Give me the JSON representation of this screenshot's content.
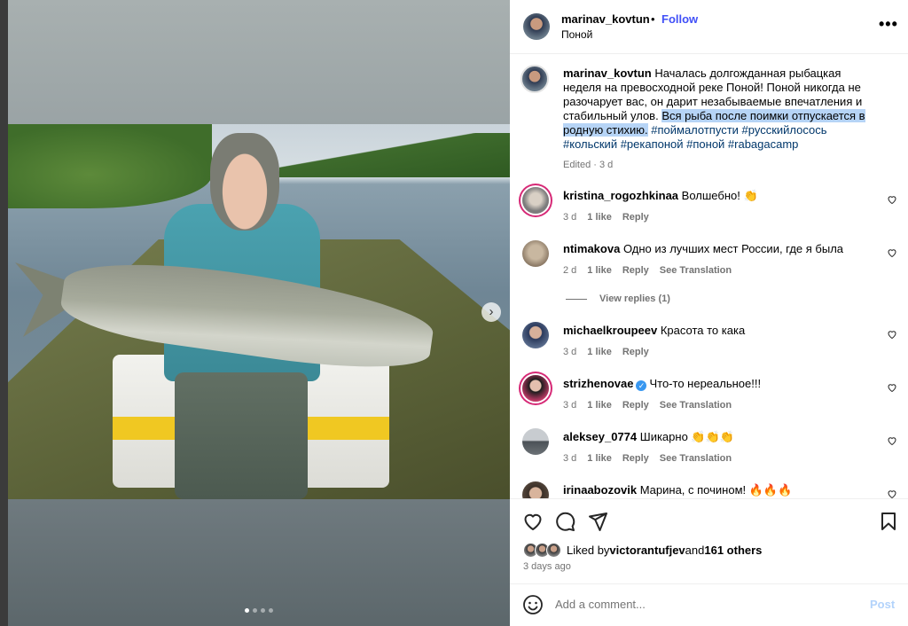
{
  "post": {
    "username": "marinav_kovtun",
    "separator": "•",
    "follow_label": "Follow",
    "location": "Поной",
    "more_label": "•••",
    "carousel_dots": 4,
    "active_dot": 0,
    "next_label": "›"
  },
  "caption": {
    "username": "marinav_kovtun",
    "text_plain": " Началась долгожданная рыбацкая неделя на превосходной реке Поной! Поной никогда не разочарует вас, он дарит незабываемые впечатления и стабильный улов. ",
    "text_highlighted": "Вся рыба после поимки отпускается в родную стихию.",
    "hashtags": " #поймалотпусти #русскийлосось #кольский #рекапоной #поной #rabagacamp",
    "edited": "Edited · 3 d"
  },
  "comments": [
    {
      "username": "kristina_rogozhkinaa",
      "text": "Волшебно! 👏",
      "time": "3 d",
      "likes": "1 like",
      "reply": "Reply",
      "translate": ""
    },
    {
      "username": "ntimakova",
      "text": "Одно из лучших мест России, где я была",
      "time": "2 d",
      "likes": "1 like",
      "reply": "Reply",
      "translate": "See Translation"
    },
    {
      "username": "michaelkroupeev",
      "text": "Красота то кака",
      "time": "3 d",
      "likes": "1 like",
      "reply": "Reply",
      "translate": ""
    },
    {
      "username": "strizhenovae",
      "text": "Что-то нереальное!!!",
      "time": "3 d",
      "likes": "1 like",
      "reply": "Reply",
      "translate": "See Translation"
    },
    {
      "username": "aleksey_0774",
      "text": "Шикарно 👏👏👏",
      "time": "3 d",
      "likes": "1 like",
      "reply": "Reply",
      "translate": "See Translation"
    },
    {
      "username": "irinaabozovik",
      "text": "Марина, с починoм! 🔥🔥🔥",
      "time": "",
      "likes": "",
      "reply": "",
      "translate": ""
    }
  ],
  "view_replies": "View replies (1)",
  "likes": {
    "prefix": "Liked by ",
    "user": "victorantufjev",
    "middle": " and ",
    "others": "161 others"
  },
  "posted_time": "3 days ago",
  "add_comment": {
    "placeholder": "Add a comment...",
    "post_label": "Post"
  },
  "colors": {
    "accent": "#4150f7",
    "post_disabled": "#b3d3fb",
    "highlight": "#b6d4f6",
    "hashtag": "#00376b"
  }
}
